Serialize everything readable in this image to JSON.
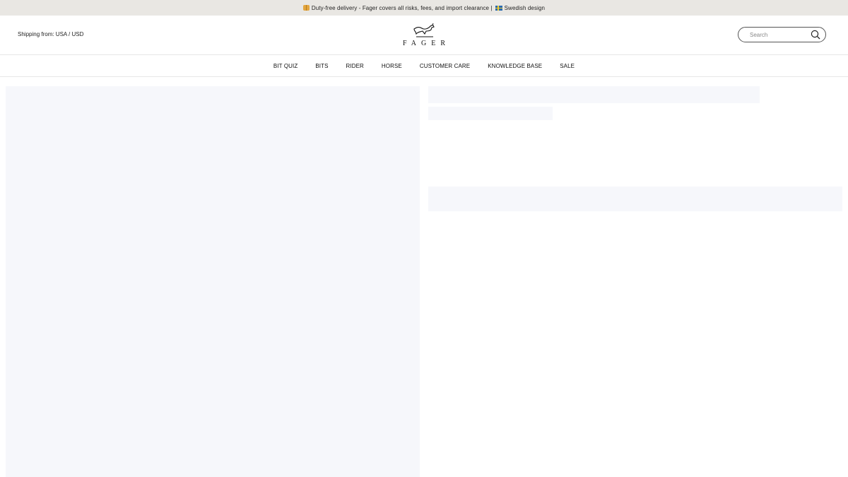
{
  "announcement": {
    "text_left": "Duty-free delivery - Fager covers all risks, fees, and import clearance |",
    "text_right": "Swedish design",
    "icons": [
      "package-icon",
      "sweden-flag-icon"
    ]
  },
  "header": {
    "shipping": "Shipping from: USA / USD",
    "logo_text": "FAGER",
    "search": {
      "placeholder": "Search",
      "value": ""
    }
  },
  "nav": {
    "items": [
      {
        "label": "BIT QUIZ"
      },
      {
        "label": "BITS"
      },
      {
        "label": "RIDER"
      },
      {
        "label": "HORSE"
      },
      {
        "label": "CUSTOMER CARE"
      },
      {
        "label": "KNOWLEDGE BASE"
      },
      {
        "label": "SALE"
      }
    ]
  },
  "colors": {
    "announcement_bg": "#e9e7e3",
    "skeleton": "#f6f7fb",
    "border": "#e6e6e6"
  }
}
